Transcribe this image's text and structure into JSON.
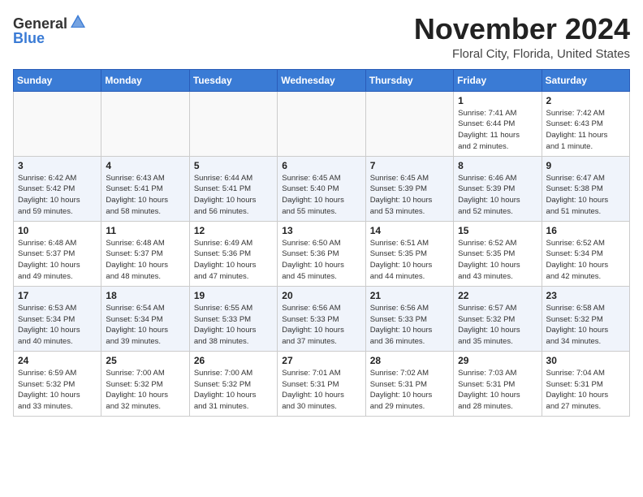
{
  "header": {
    "logo_general": "General",
    "logo_blue": "Blue",
    "month_title": "November 2024",
    "location": "Floral City, Florida, United States"
  },
  "weekdays": [
    "Sunday",
    "Monday",
    "Tuesday",
    "Wednesday",
    "Thursday",
    "Friday",
    "Saturday"
  ],
  "weeks": [
    [
      {
        "day": "",
        "info": ""
      },
      {
        "day": "",
        "info": ""
      },
      {
        "day": "",
        "info": ""
      },
      {
        "day": "",
        "info": ""
      },
      {
        "day": "",
        "info": ""
      },
      {
        "day": "1",
        "info": "Sunrise: 7:41 AM\nSunset: 6:44 PM\nDaylight: 11 hours\nand 2 minutes."
      },
      {
        "day": "2",
        "info": "Sunrise: 7:42 AM\nSunset: 6:43 PM\nDaylight: 11 hours\nand 1 minute."
      }
    ],
    [
      {
        "day": "3",
        "info": "Sunrise: 6:42 AM\nSunset: 5:42 PM\nDaylight: 10 hours\nand 59 minutes."
      },
      {
        "day": "4",
        "info": "Sunrise: 6:43 AM\nSunset: 5:41 PM\nDaylight: 10 hours\nand 58 minutes."
      },
      {
        "day": "5",
        "info": "Sunrise: 6:44 AM\nSunset: 5:41 PM\nDaylight: 10 hours\nand 56 minutes."
      },
      {
        "day": "6",
        "info": "Sunrise: 6:45 AM\nSunset: 5:40 PM\nDaylight: 10 hours\nand 55 minutes."
      },
      {
        "day": "7",
        "info": "Sunrise: 6:45 AM\nSunset: 5:39 PM\nDaylight: 10 hours\nand 53 minutes."
      },
      {
        "day": "8",
        "info": "Sunrise: 6:46 AM\nSunset: 5:39 PM\nDaylight: 10 hours\nand 52 minutes."
      },
      {
        "day": "9",
        "info": "Sunrise: 6:47 AM\nSunset: 5:38 PM\nDaylight: 10 hours\nand 51 minutes."
      }
    ],
    [
      {
        "day": "10",
        "info": "Sunrise: 6:48 AM\nSunset: 5:37 PM\nDaylight: 10 hours\nand 49 minutes."
      },
      {
        "day": "11",
        "info": "Sunrise: 6:48 AM\nSunset: 5:37 PM\nDaylight: 10 hours\nand 48 minutes."
      },
      {
        "day": "12",
        "info": "Sunrise: 6:49 AM\nSunset: 5:36 PM\nDaylight: 10 hours\nand 47 minutes."
      },
      {
        "day": "13",
        "info": "Sunrise: 6:50 AM\nSunset: 5:36 PM\nDaylight: 10 hours\nand 45 minutes."
      },
      {
        "day": "14",
        "info": "Sunrise: 6:51 AM\nSunset: 5:35 PM\nDaylight: 10 hours\nand 44 minutes."
      },
      {
        "day": "15",
        "info": "Sunrise: 6:52 AM\nSunset: 5:35 PM\nDaylight: 10 hours\nand 43 minutes."
      },
      {
        "day": "16",
        "info": "Sunrise: 6:52 AM\nSunset: 5:34 PM\nDaylight: 10 hours\nand 42 minutes."
      }
    ],
    [
      {
        "day": "17",
        "info": "Sunrise: 6:53 AM\nSunset: 5:34 PM\nDaylight: 10 hours\nand 40 minutes."
      },
      {
        "day": "18",
        "info": "Sunrise: 6:54 AM\nSunset: 5:34 PM\nDaylight: 10 hours\nand 39 minutes."
      },
      {
        "day": "19",
        "info": "Sunrise: 6:55 AM\nSunset: 5:33 PM\nDaylight: 10 hours\nand 38 minutes."
      },
      {
        "day": "20",
        "info": "Sunrise: 6:56 AM\nSunset: 5:33 PM\nDaylight: 10 hours\nand 37 minutes."
      },
      {
        "day": "21",
        "info": "Sunrise: 6:56 AM\nSunset: 5:33 PM\nDaylight: 10 hours\nand 36 minutes."
      },
      {
        "day": "22",
        "info": "Sunrise: 6:57 AM\nSunset: 5:32 PM\nDaylight: 10 hours\nand 35 minutes."
      },
      {
        "day": "23",
        "info": "Sunrise: 6:58 AM\nSunset: 5:32 PM\nDaylight: 10 hours\nand 34 minutes."
      }
    ],
    [
      {
        "day": "24",
        "info": "Sunrise: 6:59 AM\nSunset: 5:32 PM\nDaylight: 10 hours\nand 33 minutes."
      },
      {
        "day": "25",
        "info": "Sunrise: 7:00 AM\nSunset: 5:32 PM\nDaylight: 10 hours\nand 32 minutes."
      },
      {
        "day": "26",
        "info": "Sunrise: 7:00 AM\nSunset: 5:32 PM\nDaylight: 10 hours\nand 31 minutes."
      },
      {
        "day": "27",
        "info": "Sunrise: 7:01 AM\nSunset: 5:31 PM\nDaylight: 10 hours\nand 30 minutes."
      },
      {
        "day": "28",
        "info": "Sunrise: 7:02 AM\nSunset: 5:31 PM\nDaylight: 10 hours\nand 29 minutes."
      },
      {
        "day": "29",
        "info": "Sunrise: 7:03 AM\nSunset: 5:31 PM\nDaylight: 10 hours\nand 28 minutes."
      },
      {
        "day": "30",
        "info": "Sunrise: 7:04 AM\nSunset: 5:31 PM\nDaylight: 10 hours\nand 27 minutes."
      }
    ]
  ]
}
